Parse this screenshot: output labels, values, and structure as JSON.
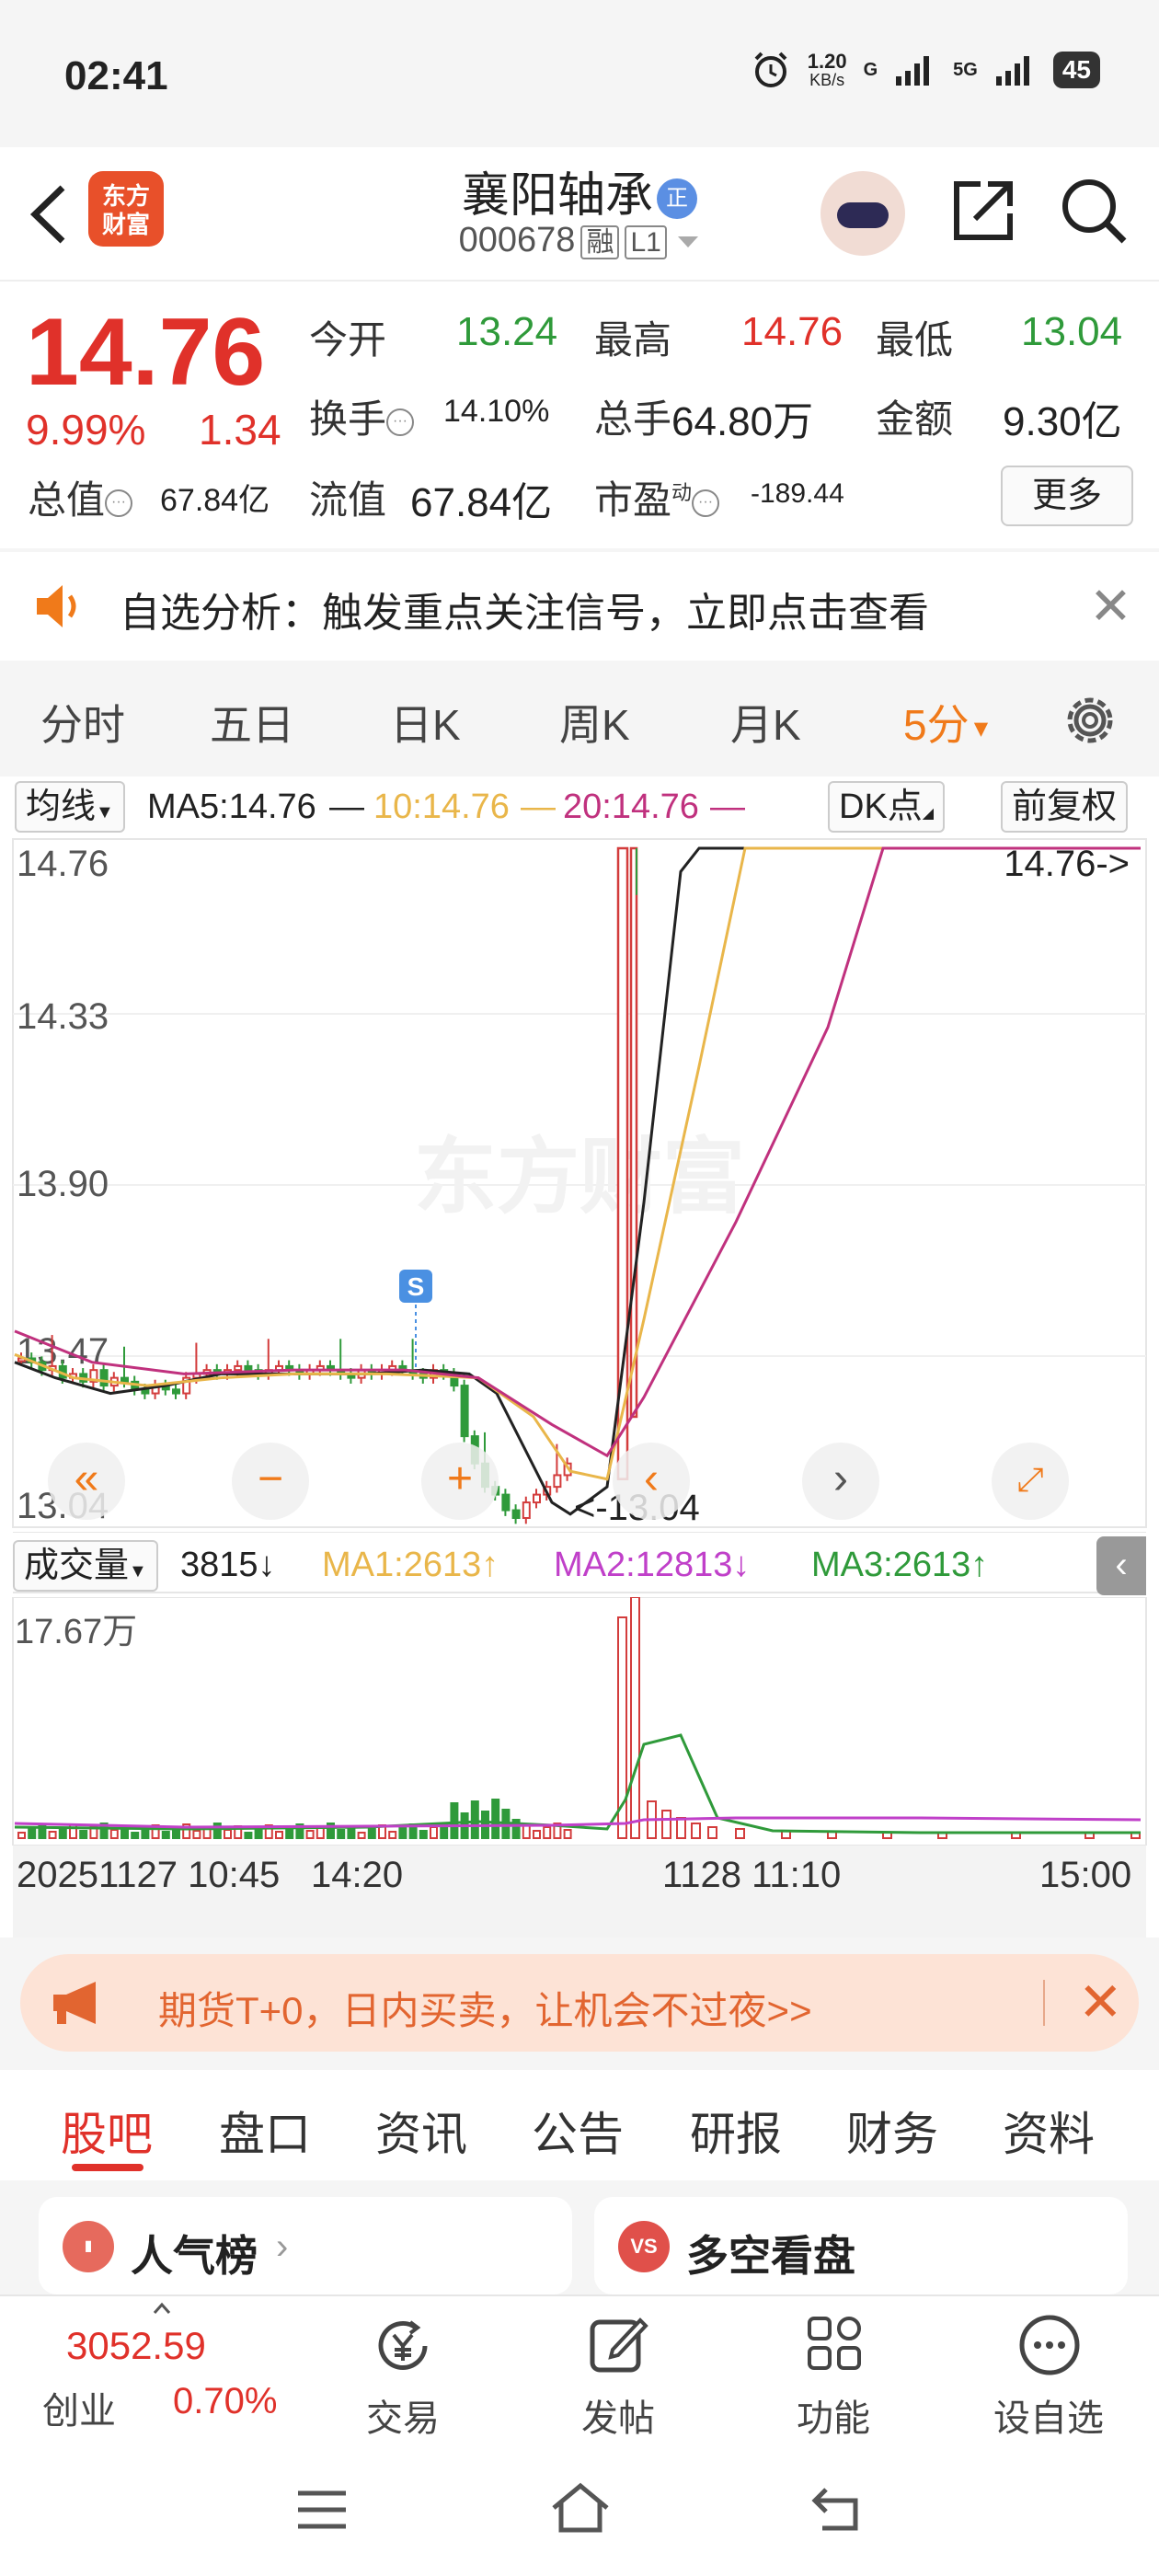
{
  "status_bar": {
    "time": "02:41",
    "net_speed": "1.20",
    "net_unit": "KB/s",
    "sig1": "G",
    "sig2": "5G",
    "battery": "45"
  },
  "header": {
    "logo_line1": "东方",
    "logo_line2": "财富",
    "stock_name": "襄阳轴承",
    "verified_badge": "正",
    "stock_code": "000678",
    "tag_rong": "融",
    "tag_level": "L1"
  },
  "quote": {
    "price": "14.76",
    "change_pct": "9.99%",
    "change": "1.34",
    "stats": [
      {
        "label": "今开",
        "value": "13.24"
      },
      {
        "label": "最高",
        "value": "14.76"
      },
      {
        "label": "最低",
        "value": "13.04"
      },
      {
        "label": "换手",
        "value": "14.10%"
      },
      {
        "label": "总手",
        "value": "64.80万"
      },
      {
        "label": "金额",
        "value": "9.30亿"
      },
      {
        "label": "总值",
        "value": "67.84亿"
      },
      {
        "label": "流值",
        "value": "67.84亿"
      },
      {
        "label": "市盈",
        "value": "-189.44"
      }
    ],
    "pe_superscript": "动",
    "more_label": "更多"
  },
  "alert": {
    "text": "自选分析：触发重点关注信号，立即点击查看"
  },
  "period_tabs": [
    "分时",
    "五日",
    "日K",
    "周K",
    "月K",
    "5分"
  ],
  "active_period": "5分",
  "ma_legend": {
    "dropdown": "均线",
    "ma5": "MA5:14.76",
    "ma10": "10:14.76",
    "ma20": "20:14.76",
    "dk_button": "DK点",
    "adjust_button": "前复权"
  },
  "chart_data": {
    "type": "candlestick",
    "price_axis_labels": [
      "14.76",
      "14.33",
      "13.90",
      "13.47",
      "13.04"
    ],
    "ylim": [
      13.04,
      14.76
    ],
    "high_marker": "14.76->",
    "low_marker": "<-13.04",
    "signal_label": "S",
    "watermark": "东方财富",
    "colors": {
      "up": "#d33c3c",
      "down": "#2f9a3a",
      "ma5": "#222222",
      "ma10": "#e9b64a",
      "ma20": "#c0317e"
    },
    "volume": {
      "dropdown": "成交量",
      "current": "3815",
      "ma1": "MA1:2613",
      "ma2": "MA2:12813",
      "ma3": "MA3:2613",
      "max_label": "17.67万"
    },
    "time_labels": [
      "20251127 10:45",
      "14:20",
      "1128 11:10",
      "15:00"
    ]
  },
  "ad": {
    "text": "期货T+0，日内买卖，让机会不过夜>>"
  },
  "sub_tabs": [
    "股吧",
    "盘口",
    "资讯",
    "公告",
    "研报",
    "财务",
    "资料"
  ],
  "active_sub_tab": "股吧",
  "cards": [
    {
      "title": "人气榜",
      "icon": "chart-icon",
      "color": "#e66a5d"
    },
    {
      "title": "多空看盘",
      "icon": "vs-icon",
      "color": "#e0504a",
      "badge": "VS"
    }
  ],
  "footer": {
    "index_value": "3052.59",
    "index_name": "创业",
    "index_change": "0.70%",
    "items": [
      "交易",
      "发帖",
      "功能",
      "设自选"
    ]
  }
}
